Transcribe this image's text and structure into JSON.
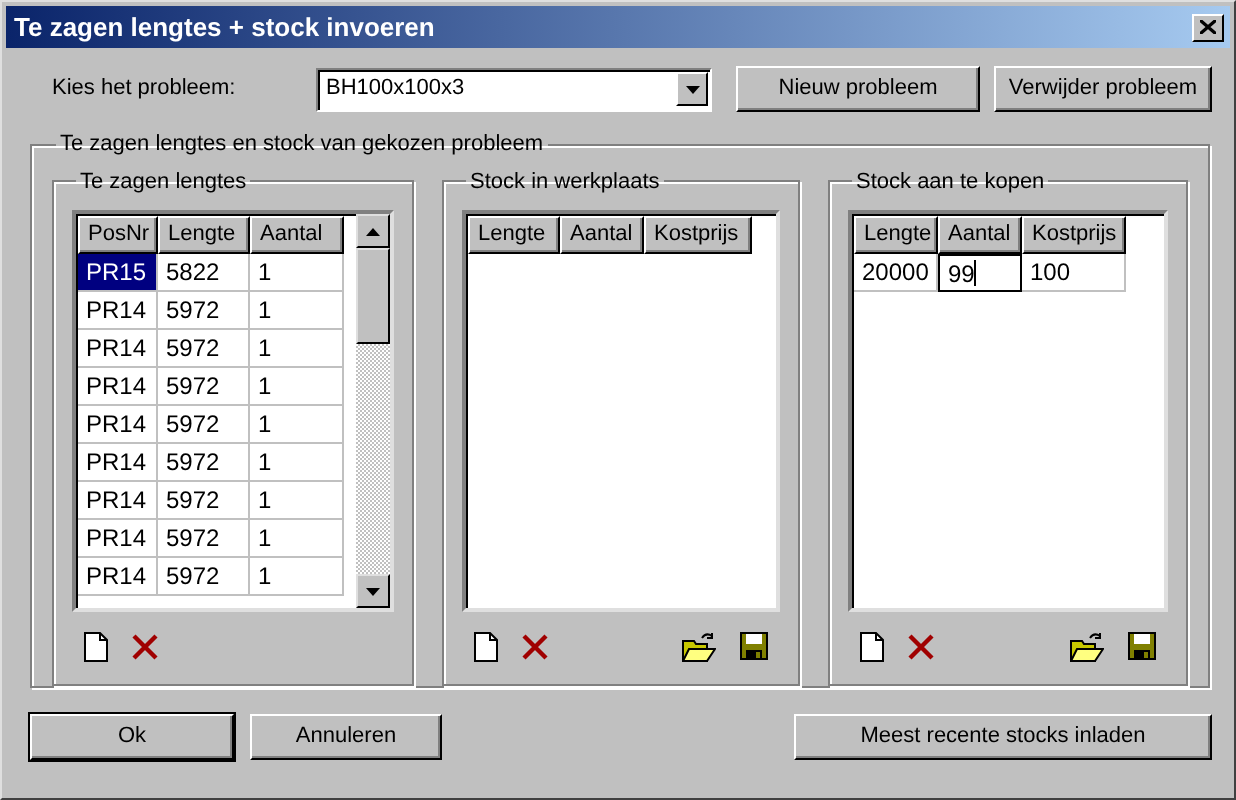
{
  "window": {
    "title": "Te zagen lengtes + stock invoeren"
  },
  "problem": {
    "label": "Kies het probleem:",
    "value": "BH100x100x3"
  },
  "top_buttons": [
    "Nieuw probleem",
    "Verwijder probleem"
  ],
  "group": {
    "title": "Te zagen lengtes en stock van gekozen probleem"
  },
  "panels": [
    {
      "title": "Te zagen lengtes",
      "scrollbar": true,
      "columns": [
        "PosNr",
        "Lengte",
        "Aantal"
      ],
      "rows": [
        {
          "cells": [
            "PR15",
            "5822",
            "1"
          ],
          "selected": true
        },
        {
          "cells": [
            "PR14",
            "5972",
            "1"
          ],
          "selected": false
        },
        {
          "cells": [
            "PR14",
            "5972",
            "1"
          ],
          "selected": false
        },
        {
          "cells": [
            "PR14",
            "5972",
            "1"
          ],
          "selected": false
        },
        {
          "cells": [
            "PR14",
            "5972",
            "1"
          ],
          "selected": false
        },
        {
          "cells": [
            "PR14",
            "5972",
            "1"
          ],
          "selected": false
        },
        {
          "cells": [
            "PR14",
            "5972",
            "1"
          ],
          "selected": false
        },
        {
          "cells": [
            "PR14",
            "5972",
            "1"
          ],
          "selected": false
        },
        {
          "cells": [
            "PR14",
            "5972",
            "1"
          ],
          "selected": false
        }
      ],
      "tools": [
        {
          "kind": "new"
        },
        {
          "kind": "delete"
        }
      ]
    },
    {
      "title": "Stock in werkplaats",
      "columns": [
        "Lengte",
        "Aantal",
        "Kostprijs"
      ],
      "tools": [
        {
          "kind": "new"
        },
        {
          "kind": "delete"
        },
        {
          "kind": "open"
        },
        {
          "kind": "save"
        }
      ]
    },
    {
      "title": "Stock aan te kopen",
      "columns": [
        "Lengte",
        "Aantal",
        "Kostprijs"
      ],
      "rows": [
        {
          "cells": [
            {
              "text": "20000",
              "editing": false
            },
            {
              "text": "99",
              "editing": true
            },
            {
              "text": "100",
              "editing": false
            }
          ]
        }
      ],
      "tools": [
        {
          "kind": "new"
        },
        {
          "kind": "delete"
        },
        {
          "kind": "open"
        },
        {
          "kind": "save"
        }
      ]
    }
  ],
  "bottom_buttons": [
    "Ok",
    "Annuleren",
    "Meest recente stocks inladen"
  ]
}
